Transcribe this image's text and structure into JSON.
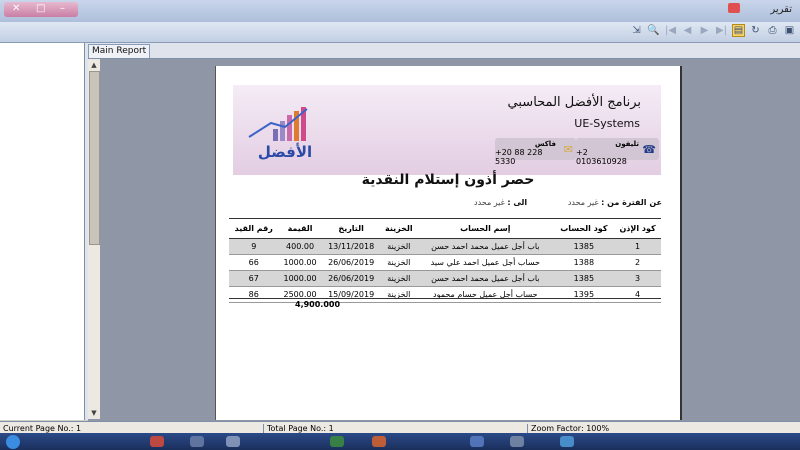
{
  "window": {
    "title": "تقرير"
  },
  "toolbar": {
    "icons": [
      "export-icon",
      "find-icon",
      "first-page-icon",
      "prev-page-icon",
      "next-page-icon",
      "last-page-icon",
      "toggle-tree-icon",
      "refresh-icon",
      "print-icon",
      "page-setup-icon"
    ]
  },
  "tabs": {
    "main_report": "Main Report"
  },
  "report": {
    "company_ar": "برنامج الأفضل المحاسبي",
    "company_en": "UE-Systems",
    "phone_label": "تليفون",
    "phone_value": "+2 0103610928",
    "fax_label": "فاكس",
    "fax_value": "+20 88 228 5330",
    "logo_text": "الأفضل",
    "title": "حصر أذون إستلام النقدية",
    "period_from_label": "عن الفترة من :",
    "period_from_value": "غير محدد",
    "period_to_label": "الى :",
    "period_to_value": "غير محدد",
    "columns": [
      "كود الإذن",
      "كود الحساب",
      "إسم الحساب",
      "الخزينة",
      "التاريخ",
      "القيمة",
      "رقم القيد"
    ],
    "rows": [
      {
        "permit": "1",
        "account_code": "1385",
        "account_name": "باب أجل عميل محمد احمد حسن",
        "treasury": "الخزينة",
        "date": "13/11/2018",
        "value": "400.00",
        "entry": "9",
        "shaded": true
      },
      {
        "permit": "2",
        "account_code": "1388",
        "account_name": "حساب أجل عميل احمد علي سيد",
        "treasury": "الخزينة",
        "date": "26/06/2019",
        "value": "1000.00",
        "entry": "66",
        "shaded": false
      },
      {
        "permit": "3",
        "account_code": "1385",
        "account_name": "باب أجل عميل محمد احمد حسن",
        "treasury": "الخزينة",
        "date": "26/06/2019",
        "value": "1000.00",
        "entry": "67",
        "shaded": true
      },
      {
        "permit": "4",
        "account_code": "1395",
        "account_name": "حساب أجل عميل حسام محمود",
        "treasury": "الخزينة",
        "date": "15/09/2019",
        "value": "2500.00",
        "entry": "86",
        "shaded": false
      }
    ],
    "total": "4,900.000"
  },
  "status": {
    "current_page": "Current Page No.: 1",
    "total_page": "Total Page No.: 1",
    "zoom": "Zoom Factor: 100%"
  },
  "colors": {
    "accent": "#c97ea4",
    "header_band": "#e3cde2",
    "row_shade": "#d6d6d6"
  }
}
